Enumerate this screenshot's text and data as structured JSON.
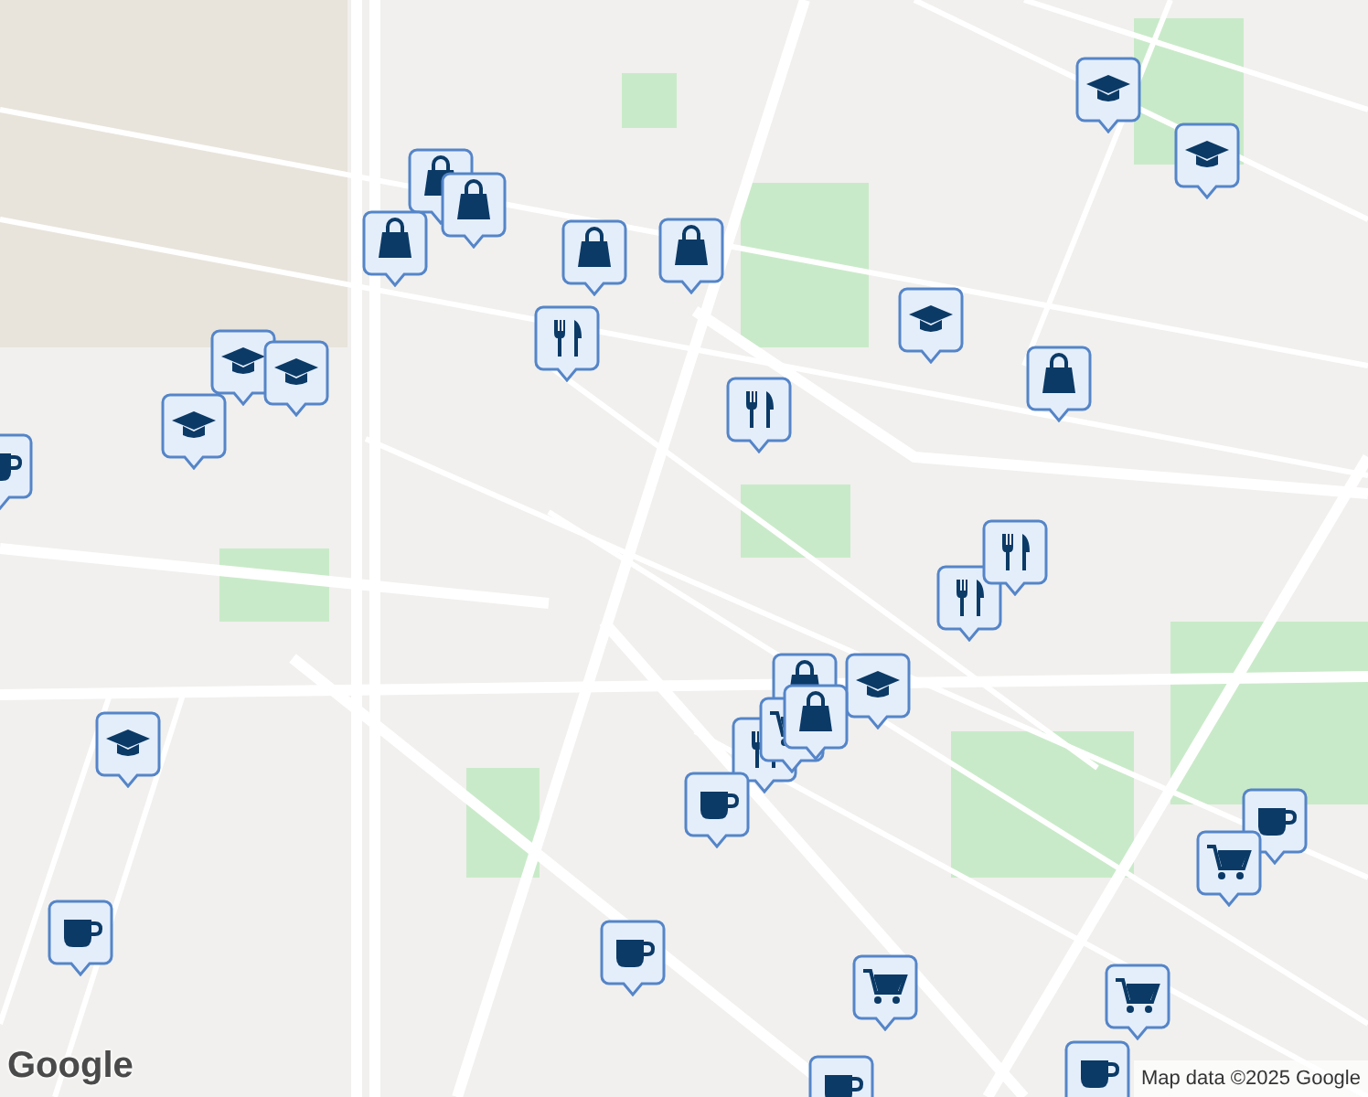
{
  "markers": [
    {
      "kind": "shop"
    },
    {
      "kind": "shop"
    },
    {
      "kind": "shop"
    },
    {
      "kind": "shop"
    },
    {
      "kind": "shop"
    },
    {
      "kind": "shop"
    },
    {
      "kind": "school"
    },
    {
      "kind": "school"
    },
    {
      "kind": "school"
    },
    {
      "kind": "school"
    },
    {
      "kind": "school"
    },
    {
      "kind": "school"
    },
    {
      "kind": "school"
    },
    {
      "kind": "food"
    },
    {
      "kind": "food"
    },
    {
      "kind": "food"
    },
    {
      "kind": "food"
    },
    {
      "kind": "cafe"
    },
    {
      "kind": "cafe"
    },
    {
      "kind": "cafe"
    },
    {
      "kind": "cafe"
    },
    {
      "kind": "shop"
    },
    {
      "kind": "school"
    },
    {
      "kind": "cart"
    },
    {
      "kind": "shop"
    },
    {
      "kind": "food"
    },
    {
      "kind": "cafe"
    },
    {
      "kind": "cart"
    },
    {
      "kind": "cart"
    },
    {
      "kind": "cart"
    },
    {
      "kind": "cafe"
    },
    {
      "kind": "cafe"
    }
  ],
  "attribution": "Map data ©2025 Google",
  "logo": "Google"
}
